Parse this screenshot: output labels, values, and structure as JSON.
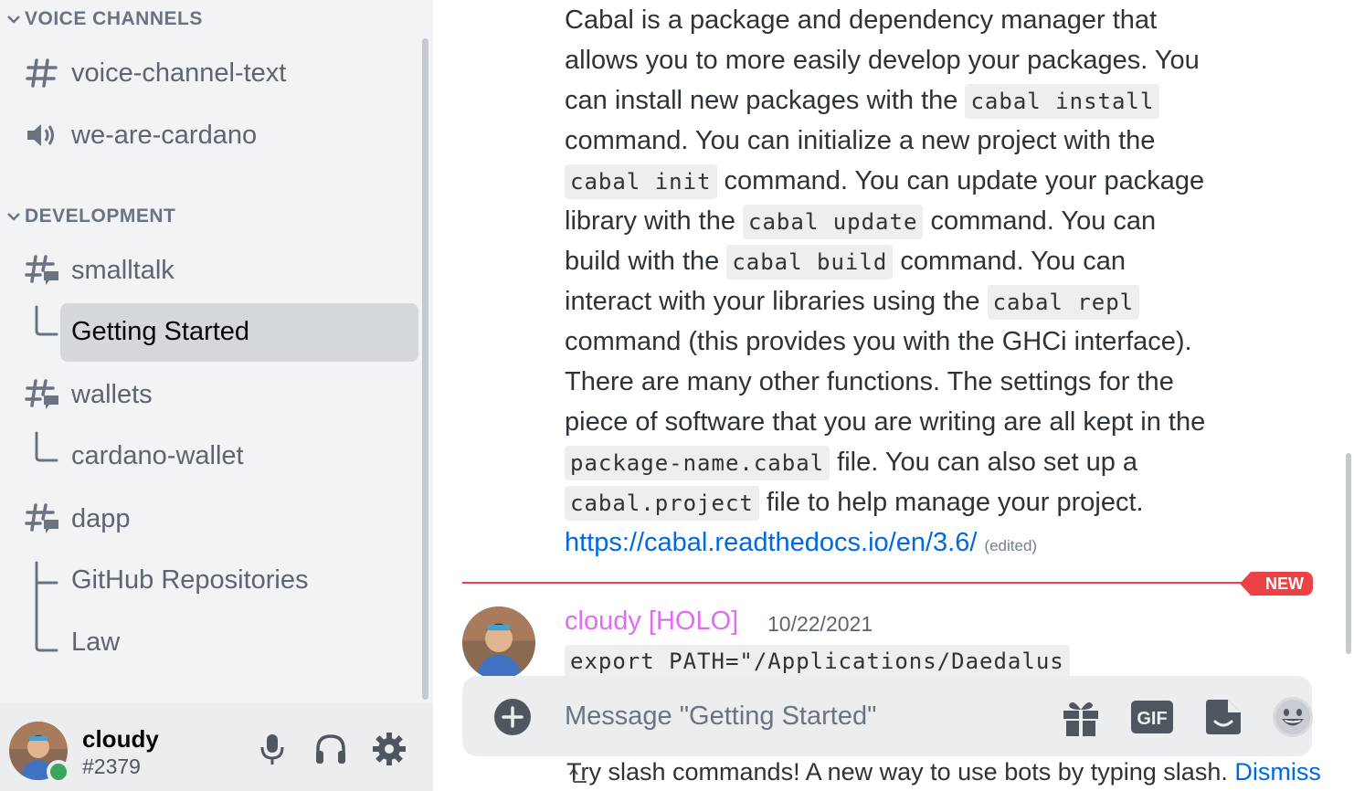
{
  "sidebar": {
    "categories": {
      "voice": "VOICE CHANNELS",
      "development": "DEVELOPMENT"
    },
    "channels": {
      "voice_channel_text": "voice-channel-text",
      "we_are_cardano": "we-are-cardano",
      "smalltalk": "smalltalk",
      "getting_started": "Getting Started",
      "wallets": "wallets",
      "cardano_wallet": "cardano-wallet",
      "dapp": "dapp",
      "github_repositories": "GitHub Repositories",
      "law": "Law"
    }
  },
  "user_panel": {
    "username": "cloudy",
    "discriminator": "#2379",
    "status": "online"
  },
  "message": {
    "lines": [
      [
        "Cabal is a package and dependency manager that"
      ],
      [
        "allows you to more easily develop your packages. You"
      ],
      [
        "can install new packages with the ",
        {
          "code": "cabal install"
        }
      ],
      [
        "command. You can initialize a new project with the"
      ],
      [
        {
          "code": "cabal init"
        },
        " command. You can update your package"
      ],
      [
        "library with the ",
        {
          "code": "cabal update"
        },
        " command. You can"
      ],
      [
        "build with the ",
        {
          "code": "cabal build"
        },
        " command. You can"
      ],
      [
        "interact with your libraries using the ",
        {
          "code": "cabal repl"
        }
      ],
      [
        "command (this provides you with the GHCi interface)."
      ],
      [
        "There are many other functions. The settings for the"
      ],
      [
        "piece of software that you are writing are all kept in the"
      ],
      [
        {
          "code": "package-name.cabal"
        },
        " file. You can also set up a"
      ],
      [
        {
          "code": "cabal.project"
        },
        " file to help manage your project."
      ]
    ],
    "link": "https://cabal.readthedocs.io/en/3.6/",
    "edited": "(edited)"
  },
  "new_badge": "NEW",
  "next_message": {
    "author": "cloudy [HOLO]",
    "date": "10/22/2021",
    "code_preview": "export PATH=\"/Applications/Daedalus"
  },
  "composer": {
    "placeholder": "Message \"Getting Started\"",
    "gif_label": "GIF"
  },
  "tip": {
    "text": "Try slash commands! A new way to use bots by typing slash.",
    "dismiss": "Dismiss"
  },
  "colors": {
    "accent_link": "#0068e0",
    "new_red": "#ed4245",
    "author_pink": "#e06cf5",
    "online_green": "#3ba55d"
  }
}
